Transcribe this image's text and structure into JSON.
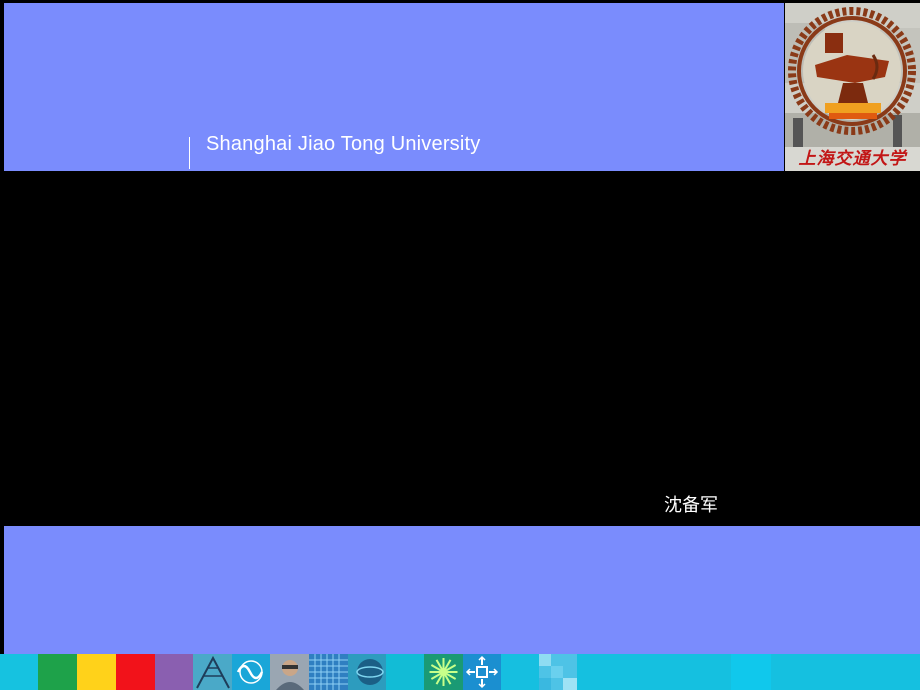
{
  "header": {
    "university_name_en": "Shanghai Jiao Tong University",
    "logo_text_cn": "上海交通大学"
  },
  "author": "沈备军",
  "colors": {
    "banner": "#7a8cfd",
    "background": "#000000",
    "logo_red": "#c21616"
  },
  "footer_strip": {
    "tiles": [
      {
        "name": "cyan",
        "color": "#16c2e0"
      },
      {
        "name": "green",
        "color": "#1ea24a"
      },
      {
        "name": "yellow",
        "color": "#ffd21a"
      },
      {
        "name": "red",
        "color": "#f2121a"
      },
      {
        "name": "purple",
        "color": "#8a5fb0"
      },
      {
        "name": "photo-crane",
        "color": "#4aa9c8"
      },
      {
        "name": "wave-icon",
        "color": "#1aa6d8"
      },
      {
        "name": "photo-person",
        "color": "#9aa6b2"
      },
      {
        "name": "photo-grid",
        "color": "#2f7fc1"
      },
      {
        "name": "photo-sphere",
        "color": "#2d9cbe"
      },
      {
        "name": "cyan-plain",
        "color": "#12bcd6"
      },
      {
        "name": "starburst-icon",
        "color": "#1a9a74"
      },
      {
        "name": "arrows-icon",
        "color": "#1b8fd0"
      },
      {
        "name": "cyan-plain-2",
        "color": "#16bfe0"
      },
      {
        "name": "mosaic",
        "color": "#4ec3e6"
      },
      {
        "name": "cyan-wide",
        "color": "#15c0e0"
      },
      {
        "name": "cyan-light",
        "color": "#10c8ec"
      },
      {
        "name": "cyan-end",
        "color": "#15c0e0"
      }
    ]
  }
}
